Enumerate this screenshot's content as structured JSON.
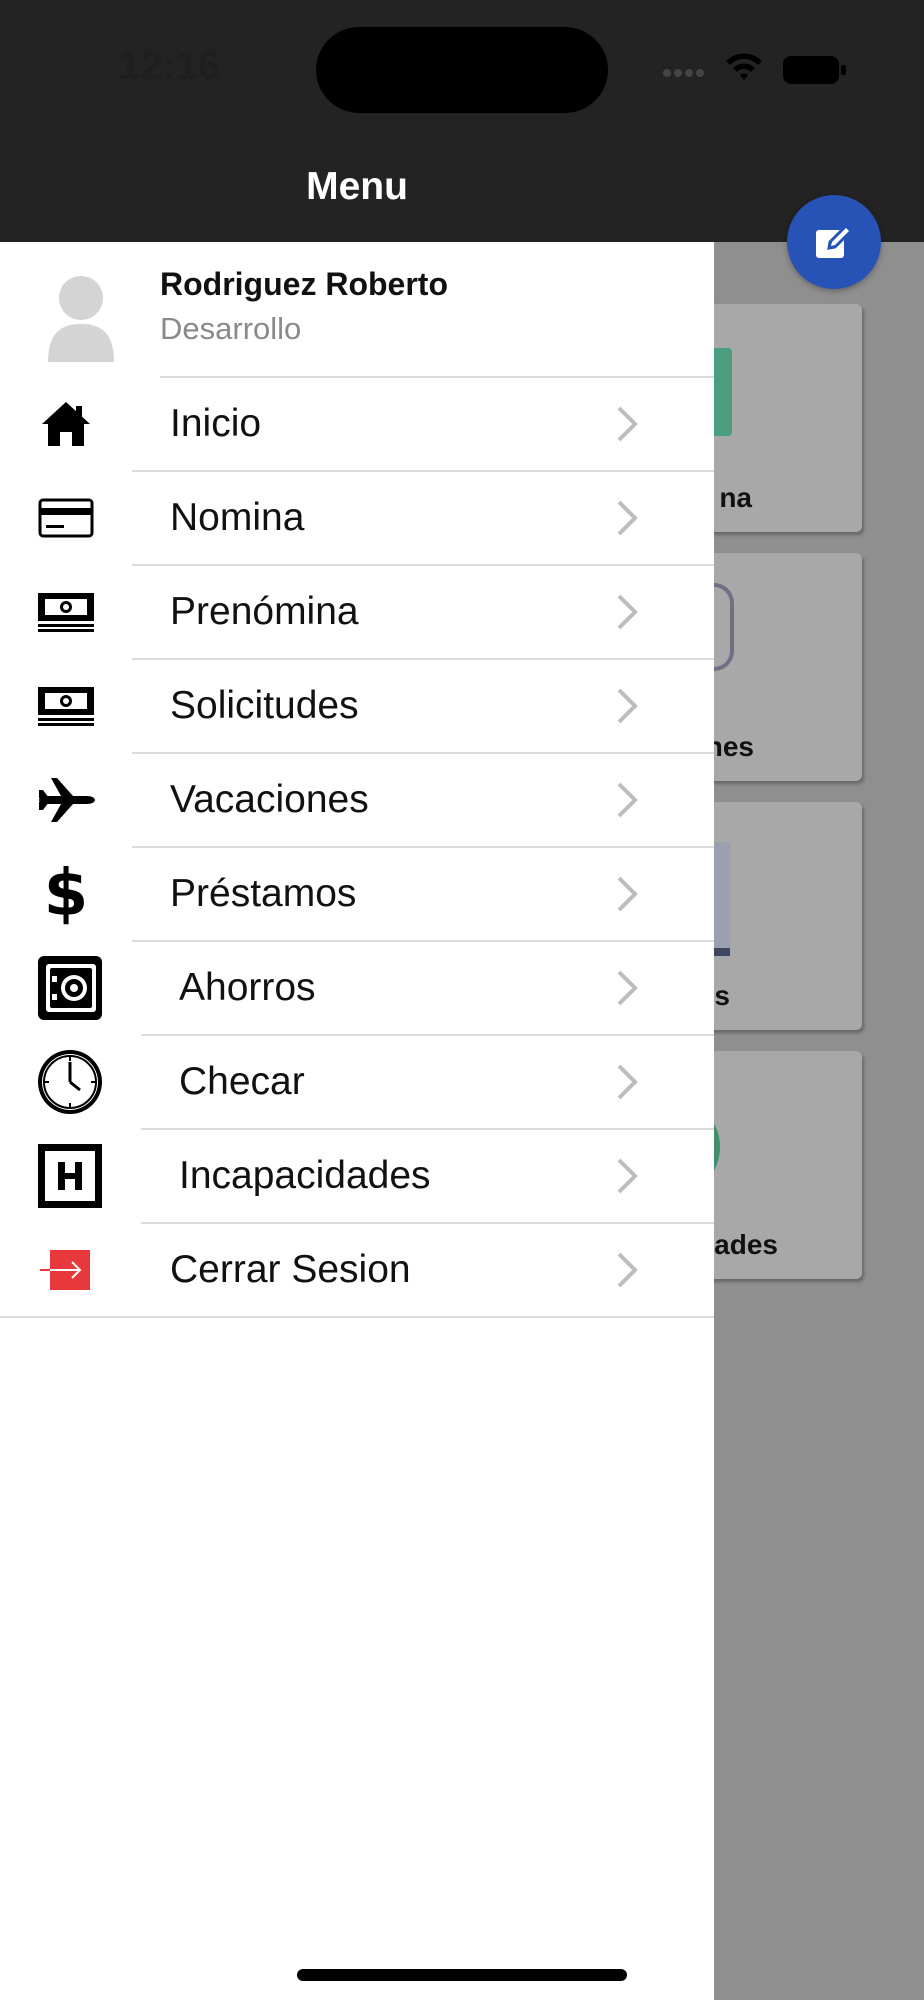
{
  "status_bar": {
    "time": "12:16"
  },
  "background": {
    "cards": [
      {
        "label": "na"
      },
      {
        "label": "nes"
      },
      {
        "label": "s"
      },
      {
        "label": "ades"
      }
    ]
  },
  "drawer": {
    "title": "Menu",
    "user": {
      "name": "Rodriguez Roberto",
      "department": "Desarrollo"
    },
    "items": [
      {
        "label": "Inicio",
        "icon": "home-icon"
      },
      {
        "label": "Nomina",
        "icon": "credit-card-icon"
      },
      {
        "label": "Prenómina",
        "icon": "cash-icon"
      },
      {
        "label": "Solicitudes",
        "icon": "cash-icon"
      },
      {
        "label": "Vacaciones",
        "icon": "airplane-icon"
      },
      {
        "label": "Préstamos",
        "icon": "dollar-icon"
      },
      {
        "label": "Ahorros",
        "icon": "safe-icon"
      },
      {
        "label": "Checar",
        "icon": "clock-icon"
      },
      {
        "label": "Incapacidades",
        "icon": "hospital-icon"
      },
      {
        "label": "Cerrar Sesion",
        "icon": "logout-icon"
      }
    ]
  },
  "colors": {
    "header": "#232323",
    "fab": "#2753b6",
    "logout": "#e8383b"
  }
}
